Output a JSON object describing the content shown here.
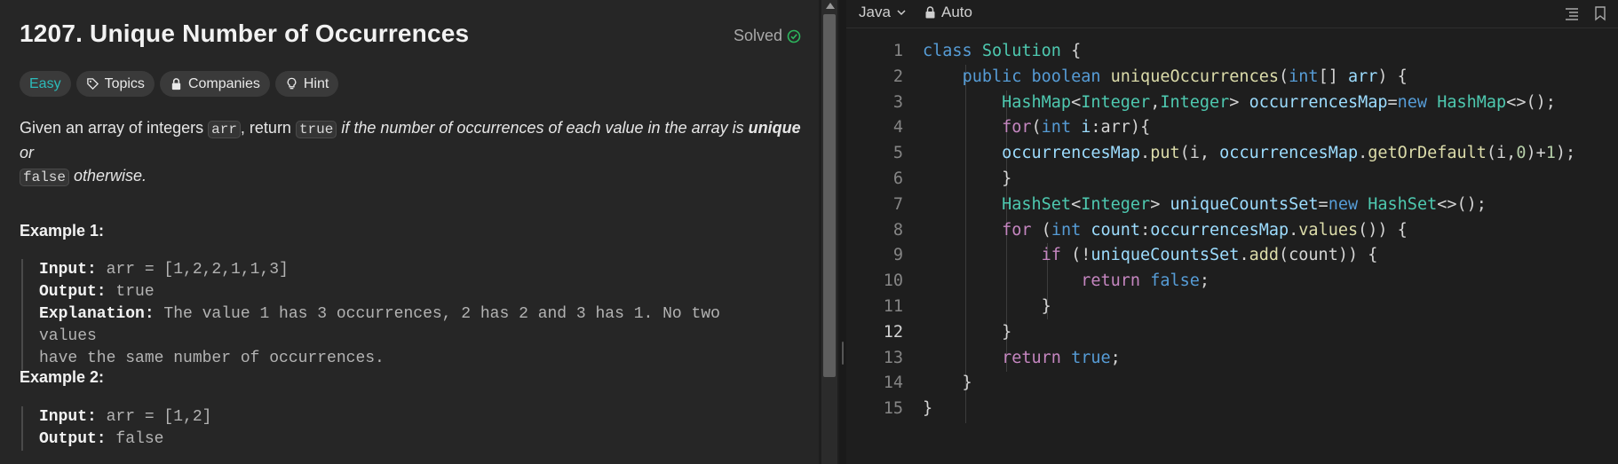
{
  "problem": {
    "title": "1207. Unique Number of Occurrences",
    "solved_label": "Solved",
    "tags": {
      "difficulty": "Easy",
      "topics": "Topics",
      "companies": "Companies",
      "hint": "Hint"
    },
    "description": {
      "p1": "Given an array of integers ",
      "code_arr": "arr",
      "p2": ", return ",
      "code_true": "true",
      "p3_italic": " if the number of occurrences of each value in the array is ",
      "p3_bold": "unique",
      "p3_tail": " or",
      "code_false": "false",
      "p4_italic": " otherwise."
    },
    "examples": [
      {
        "title": "Example 1:",
        "input_label": "Input:",
        "input_value": " arr = [1,2,2,1,1,3]",
        "output_label": "Output:",
        "output_value": " true",
        "explanation_label": "Explanation:",
        "explanation_line1": " The value 1 has 3 occurrences, 2 has 2 and 3 has 1. No two values",
        "explanation_line2": "have the same number of occurrences."
      },
      {
        "title": "Example 2:",
        "input_label": "Input:",
        "input_value": " arr = [1,2]",
        "output_label": "Output:",
        "output_value": " false"
      }
    ]
  },
  "editor": {
    "language": "Java",
    "mode": "Auto",
    "active_line": 12,
    "line_numbers": [
      "1",
      "2",
      "3",
      "4",
      "5",
      "6",
      "7",
      "8",
      "9",
      "10",
      "11",
      "12",
      "13",
      "14",
      "15"
    ]
  },
  "colors": {
    "easy": "#2cbbba",
    "solved_check": "#2db55d",
    "keyword": "#569cd6",
    "control": "#c586c0",
    "type": "#4ec9b0",
    "function": "#dcdcaa",
    "variable": "#9cdcfe",
    "number": "#b5cea8"
  }
}
